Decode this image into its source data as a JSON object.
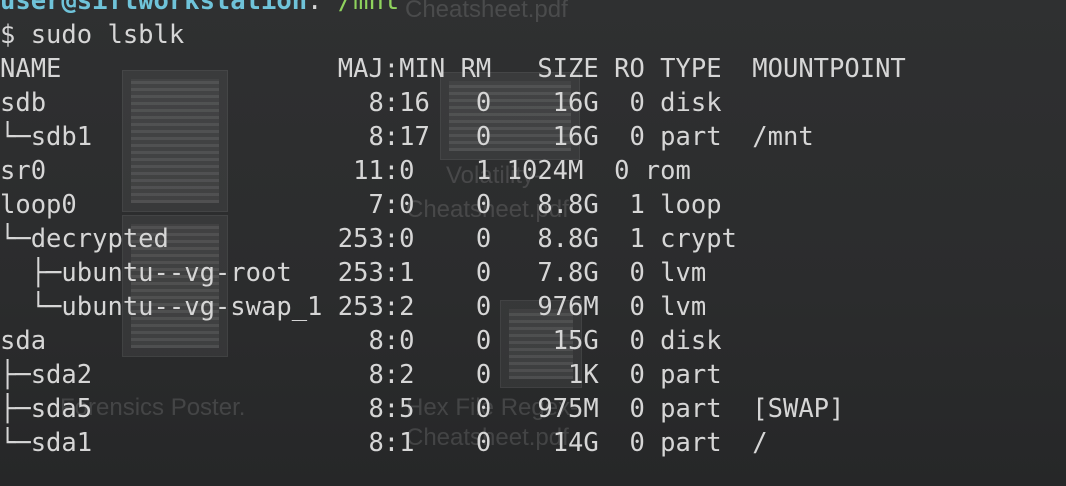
{
  "prompt": {
    "user_host": "user@siftworkstation",
    "separator": ": ",
    "cwd": "/mnt"
  },
  "command": "$ sudo lsblk",
  "table_header": "NAME                  MAJ:MIN RM   SIZE RO TYPE  MOUNTPOINT",
  "table_rows": [
    "sdb                     8:16   0    16G  0 disk  ",
    "└─sdb1                  8:17   0    16G  0 part  /mnt",
    "sr0                    11:0    1 1024M  0 rom   ",
    "loop0                   7:0    0   8.8G  1 loop  ",
    "└─decrypted           253:0    0   8.8G  1 crypt ",
    "  ├─ubuntu--vg-root   253:1    0   7.8G  0 lvm   ",
    "  └─ubuntu--vg-swap_1 253:2    0   976M  0 lvm   ",
    "sda                     8:0    0    15G  0 disk  ",
    "├─sda2                  8:2    0     1K  0 part  ",
    "├─sda5                  8:5    0   975M  0 part  [SWAP]",
    "└─sda1                  8:1    0    14G  0 part  /"
  ],
  "desktop_icons": [
    {
      "icon": "pdf-file-icon",
      "label": "Cheatsheet.pdf"
    },
    {
      "icon": "pdf-file-icon",
      "label": "Volatility-"
    },
    {
      "icon": "pdf-file-icon",
      "label": "Cheatsheet.pdf"
    },
    {
      "icon": "pdf-file-icon",
      "label": "Hex File Regex-"
    },
    {
      "icon": "pdf-file-icon",
      "label": "Cheatsheet.pdf"
    },
    {
      "icon": "pdf-file-icon",
      "label": "Forensics Poster."
    }
  ],
  "colors": {
    "background": "#2b2d2e",
    "text": "#d6d6d6",
    "user_host": "#6fc3d9",
    "path": "#8fd35d"
  }
}
